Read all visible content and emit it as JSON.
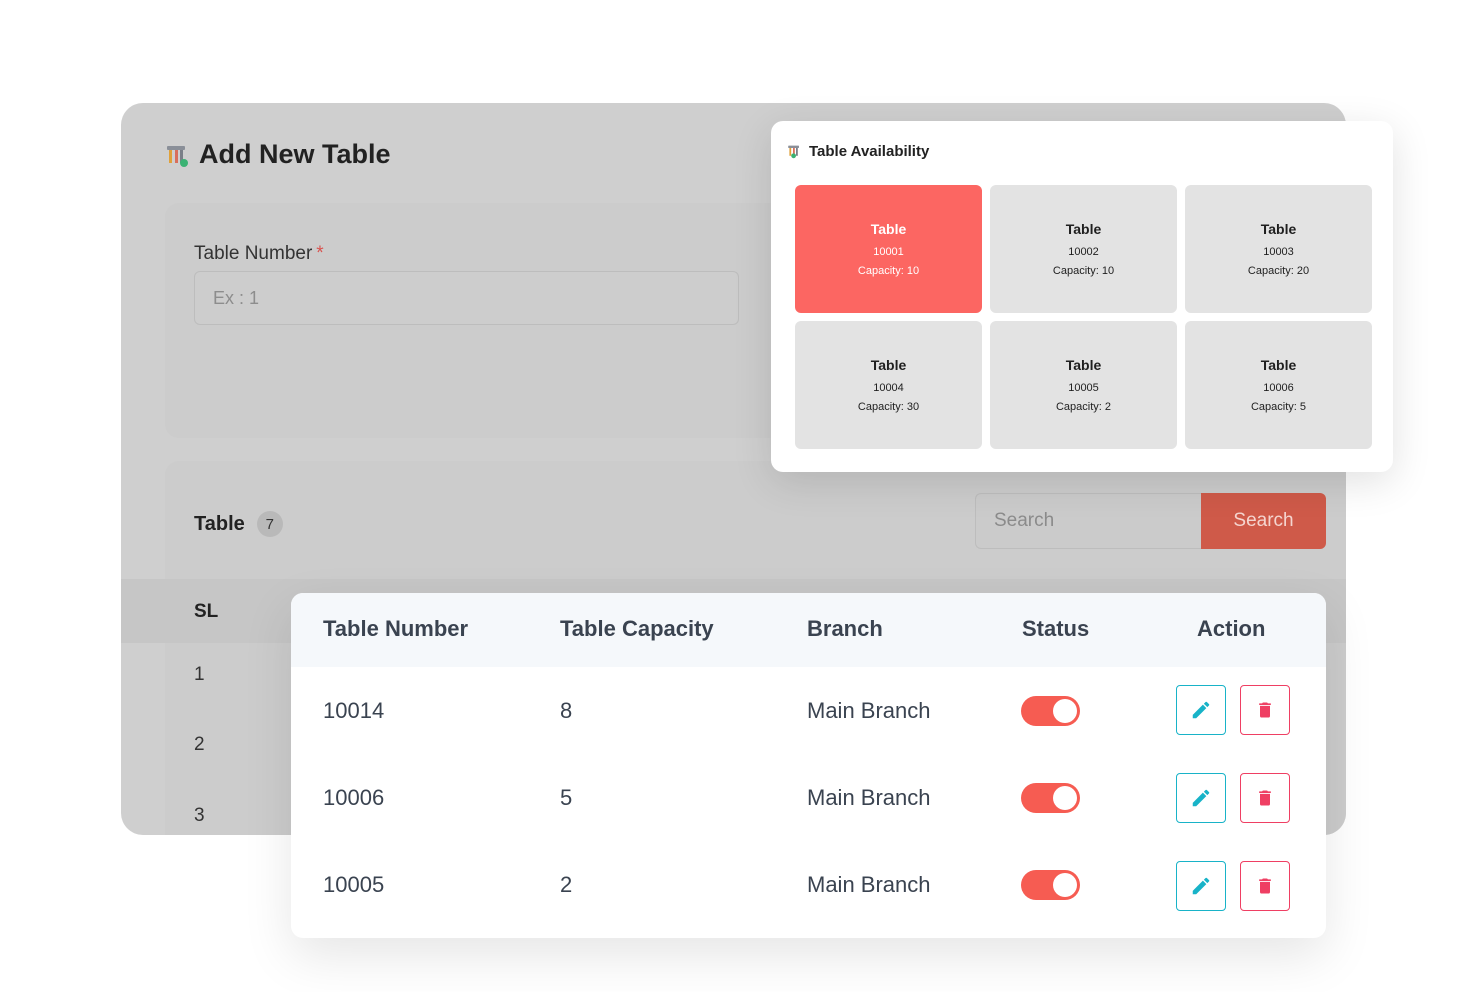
{
  "back_panel": {
    "page_title": "Add New Table",
    "form": {
      "table_number_label": "Table Number",
      "required_marker": "*",
      "table_number_placeholder": "Ex : 1"
    },
    "list": {
      "title": "Table",
      "count": "7",
      "search_placeholder": "Search",
      "search_button": "Search",
      "sl_header": "SL",
      "sl_values": [
        "1",
        "2",
        "3"
      ]
    }
  },
  "availability": {
    "title": "Table Availability",
    "tiles": [
      {
        "label": "Table",
        "number": "10001",
        "capacity": "Capacity: 10",
        "active": true
      },
      {
        "label": "Table",
        "number": "10002",
        "capacity": "Capacity: 10",
        "active": false
      },
      {
        "label": "Table",
        "number": "10003",
        "capacity": "Capacity: 20",
        "active": false
      },
      {
        "label": "Table",
        "number": "10004",
        "capacity": "Capacity: 30",
        "active": false
      },
      {
        "label": "Table",
        "number": "10005",
        "capacity": "Capacity: 2",
        "active": false
      },
      {
        "label": "Table",
        "number": "10006",
        "capacity": "Capacity: 5",
        "active": false
      }
    ]
  },
  "table": {
    "headers": [
      "Table Number",
      "Table Capacity",
      "Branch",
      "Status",
      "Action"
    ],
    "rows": [
      {
        "number": "10014",
        "capacity": "8",
        "branch": "Main Branch",
        "status_on": true
      },
      {
        "number": "10006",
        "capacity": "5",
        "branch": "Main Branch",
        "status_on": true
      },
      {
        "number": "10005",
        "capacity": "2",
        "branch": "Main Branch",
        "status_on": true
      }
    ]
  },
  "colors": {
    "accent_red": "#fc6662",
    "toggle_on": "#f65c52",
    "edit_border": "#18b3c8",
    "delete_border": "#ef3f63"
  },
  "icons": {
    "title_icon": "table-icon",
    "edit_icon": "pencil-icon",
    "delete_icon": "trash-icon"
  }
}
